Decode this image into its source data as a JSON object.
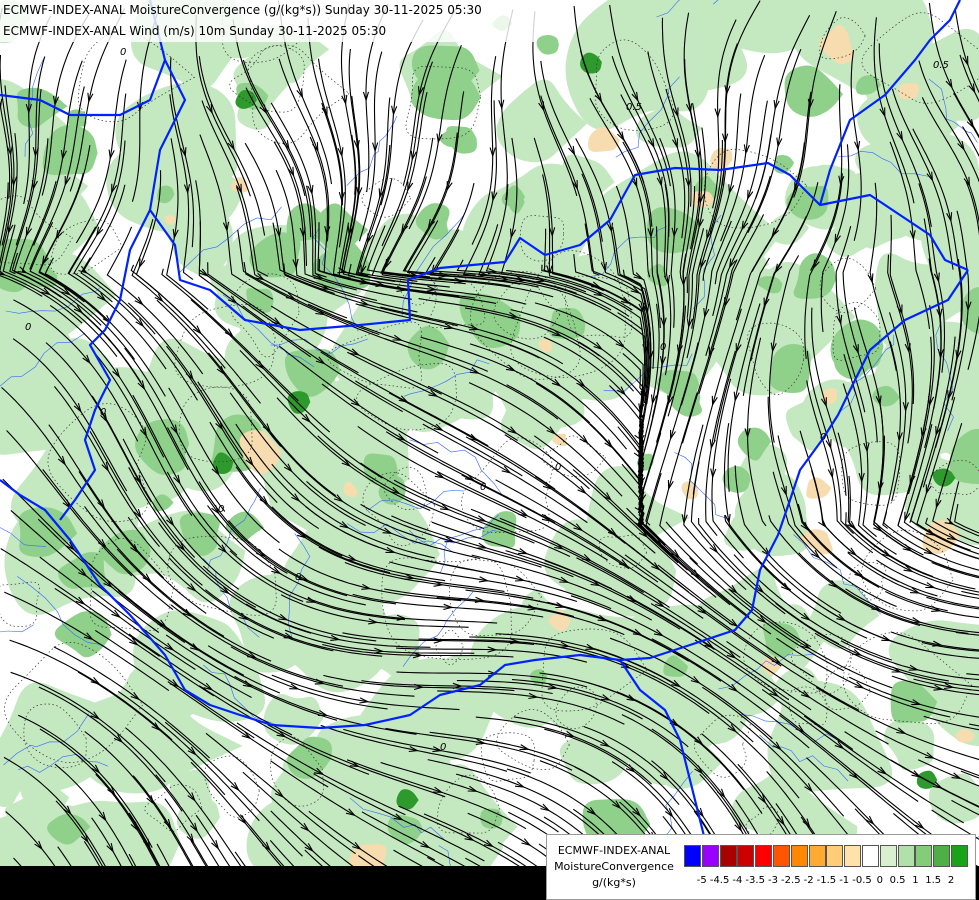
{
  "header": {
    "line1": "ECMWF-INDEX-ANAL MoistureConvergence (g/(kg*s)) Sunday 30-11-2025 05:30",
    "line2": "ECMWF-INDEX-ANAL Wind (m/s) 10m Sunday 30-11-2025 05:30"
  },
  "legend": {
    "model": "ECMWF-INDEX-ANAL",
    "parameter": "MoistureConvergence",
    "unit": "g/(kg*s)",
    "colors": [
      "#0000ff",
      "#9900ff",
      "#aa0000",
      "#cc0000",
      "#ff0000",
      "#ff5500",
      "#ff8800",
      "#ffaa33",
      "#ffcc77",
      "#ffe2aa",
      "#ffffff",
      "#d8f0d0",
      "#b2e0aa",
      "#84cc7a",
      "#4faf47",
      "#18a318"
    ],
    "ticks": [
      "-5",
      "-4.5",
      "-4",
      "-3.5",
      "-3",
      "-2.5",
      "-2",
      "-1.5",
      "-1",
      "-0.5",
      "0",
      "0.5",
      "1",
      "1.5",
      "2"
    ]
  },
  "contour_labels": [
    "0",
    "0",
    "0",
    "0",
    "0",
    "0",
    "0",
    "0",
    "0",
    "0",
    "0.5",
    "0.5"
  ],
  "colors": {
    "border": "#0022ff",
    "river": "#3366ff",
    "streamline": "#000000",
    "green_light": "#c4e8c0",
    "green_mid": "#8fd18a",
    "green_dark": "#2e9a2e",
    "orange_light": "#f6dcae"
  }
}
